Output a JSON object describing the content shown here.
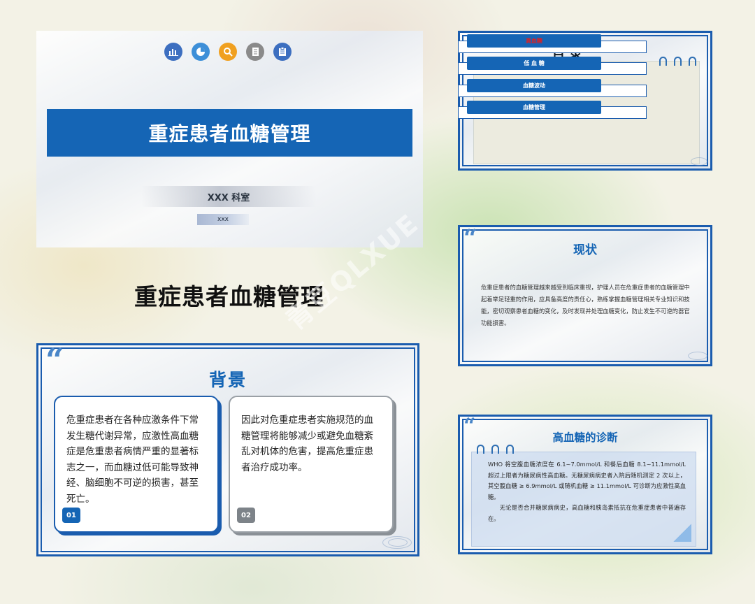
{
  "cover": {
    "icons": [
      "bar-chart-icon",
      "pie-chart-icon",
      "magnifier-icon",
      "notebook-icon",
      "clipboard-icon"
    ],
    "icon_colors": [
      "#3d6fc0",
      "#3d8fd8",
      "#f0a020",
      "#8a8a8a",
      "#3d6fc0"
    ],
    "title": "重症患者血糖管理",
    "department": "XXX 科室",
    "presenter": "xxx"
  },
  "big_title": "重症患者血糖管理",
  "watermark": "青豆QLXUE",
  "toc": {
    "heading_peek": "目 录",
    "items": [
      "高血糖",
      "低 血 糖",
      "血糖波动",
      "血糖管理"
    ]
  },
  "status": {
    "heading": "现状",
    "body": "危重症患者的血糖管理越来越受到临床重视，护理人员在危重症患者的血糖管理中起着举足轻重的作用，应具备高度的责任心，熟练掌握血糖管理相关专业知识和技能，密切观察患者血糖的变化，及时发现并处理血糖变化，防止发生不可逆的器官功能损害。"
  },
  "background": {
    "heading": "背景",
    "cards": [
      {
        "text": "危重症患者在各种应激条件下常发生糖代谢异常，应激性高血糖症是危重患者病情严重的显著标志之一，而血糖过低可能导致神经、脑细胞不可逆的损害，甚至死亡。",
        "badge": "01"
      },
      {
        "text": "因此对危重症患者实施规范的血糖管理将能够减少或避免血糖紊乱对机体的危害，提高危重症患者治疗成功率。",
        "badge": "02"
      }
    ]
  },
  "diagnosis": {
    "heading": "高血糖的诊断",
    "para1": "WHO 将空腹血糖浓度在 6.1~7.0mmol/L 和餐后血糖 8.1~11.1mmol/L 超过上限者为糖尿病性高血糖。无糖尿病病史者入院后随机测定 2 次以上，其空腹血糖 ≥ 6.9mmol/L 或随机血糖 ≥ 11.1mmol/L 可诊断为应激性高血糖。",
    "para2": "无论是否合并糖尿病病史，高血糖和胰岛素抵抗在危重症患者中普遍存在。"
  }
}
